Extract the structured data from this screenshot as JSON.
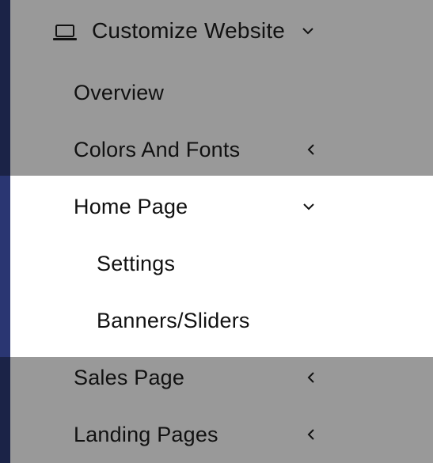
{
  "colors": {
    "menu_background": "#999999",
    "active_background": "#ffffff",
    "accent_bar_top": "#1b2347",
    "accent_bar_active": "#2a3672",
    "text": "#111111"
  },
  "menu": {
    "header": {
      "label": "Customize Website",
      "icon": "laptop-icon",
      "chevron": "chevron-down-icon"
    },
    "items": [
      {
        "label": "Overview"
      },
      {
        "label": "Colors And Fonts",
        "chevron": "chevron-left-icon"
      },
      {
        "label": "Home Page",
        "chevron": "chevron-down-icon",
        "active": true,
        "children": [
          {
            "label": "Settings"
          },
          {
            "label": "Banners/Sliders"
          }
        ]
      },
      {
        "label": "Sales Page",
        "chevron": "chevron-left-icon"
      },
      {
        "label": "Landing Pages",
        "chevron": "chevron-left-icon"
      }
    ]
  }
}
